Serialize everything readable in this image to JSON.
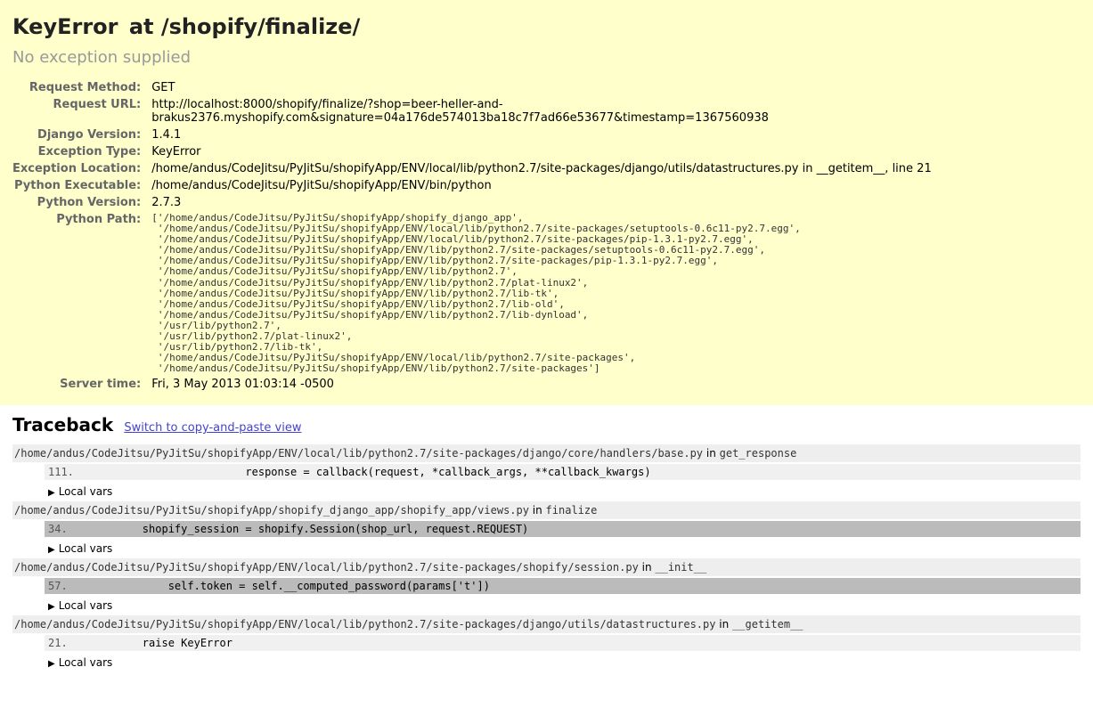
{
  "summary": {
    "heading_error": "KeyError",
    "heading_at": "at /shopify/finalize/",
    "exception_message": "No exception supplied",
    "rows": {
      "request_method_label": "Request Method:",
      "request_method": "GET",
      "request_url_label": "Request URL:",
      "request_url": "http://localhost:8000/shopify/finalize/?shop=beer-heller-and-brakus2376.myshopify.com&signature=04a176de574013ba18c7f7ad66e53677&timestamp=1367560938",
      "django_version_label": "Django Version:",
      "django_version": "1.4.1",
      "exception_type_label": "Exception Type:",
      "exception_type": "KeyError",
      "exception_location_label": "Exception Location:",
      "exception_location": "/home/andus/CodeJitsu/PyJitSu/shopifyApp/ENV/local/lib/python2.7/site-packages/django/utils/datastructures.py in __getitem__, line 21",
      "python_executable_label": "Python Executable:",
      "python_executable": "/home/andus/CodeJitsu/PyJitSu/shopifyApp/ENV/bin/python",
      "python_version_label": "Python Version:",
      "python_version": "2.7.3",
      "python_path_label": "Python Path:",
      "python_path": "['/home/andus/CodeJitsu/PyJitSu/shopifyApp/shopify_django_app',\n '/home/andus/CodeJitsu/PyJitSu/shopifyApp/ENV/local/lib/python2.7/site-packages/setuptools-0.6c11-py2.7.egg',\n '/home/andus/CodeJitsu/PyJitSu/shopifyApp/ENV/local/lib/python2.7/site-packages/pip-1.3.1-py2.7.egg',\n '/home/andus/CodeJitsu/PyJitSu/shopifyApp/ENV/lib/python2.7/site-packages/setuptools-0.6c11-py2.7.egg',\n '/home/andus/CodeJitsu/PyJitSu/shopifyApp/ENV/lib/python2.7/site-packages/pip-1.3.1-py2.7.egg',\n '/home/andus/CodeJitsu/PyJitSu/shopifyApp/ENV/lib/python2.7',\n '/home/andus/CodeJitsu/PyJitSu/shopifyApp/ENV/lib/python2.7/plat-linux2',\n '/home/andus/CodeJitsu/PyJitSu/shopifyApp/ENV/lib/python2.7/lib-tk',\n '/home/andus/CodeJitsu/PyJitSu/shopifyApp/ENV/lib/python2.7/lib-old',\n '/home/andus/CodeJitsu/PyJitSu/shopifyApp/ENV/lib/python2.7/lib-dynload',\n '/usr/lib/python2.7',\n '/usr/lib/python2.7/plat-linux2',\n '/usr/lib/python2.7/lib-tk',\n '/home/andus/CodeJitsu/PyJitSu/shopifyApp/ENV/local/lib/python2.7/site-packages',\n '/home/andus/CodeJitsu/PyJitSu/shopifyApp/ENV/lib/python2.7/site-packages']",
      "server_time_label": "Server time:",
      "server_time": "Fri, 3 May 2013 01:03:14 -0500"
    }
  },
  "traceback": {
    "heading": "Traceback",
    "switch_link": "Switch to copy-and-paste view",
    "local_vars_label": "Local vars",
    "in_word": "in",
    "frames": [
      {
        "file": "/home/andus/CodeJitsu/PyJitSu/shopifyApp/ENV/local/lib/python2.7/site-packages/django/core/handlers/base.py",
        "func": "get_response",
        "lineno": "111.",
        "code": "                        response = callback(request, *callback_args, **callback_kwargs)",
        "highlight": false
      },
      {
        "file": "/home/andus/CodeJitsu/PyJitSu/shopifyApp/shopify_django_app/shopify_app/views.py",
        "func": "finalize",
        "lineno": "34.",
        "code": "        shopify_session = shopify.Session(shop_url, request.REQUEST)",
        "highlight": true
      },
      {
        "file": "/home/andus/CodeJitsu/PyJitSu/shopifyApp/ENV/local/lib/python2.7/site-packages/shopify/session.py",
        "func": "__init__",
        "lineno": "57.",
        "code": "            self.token = self.__computed_password(params['t'])",
        "highlight": true
      },
      {
        "file": "/home/andus/CodeJitsu/PyJitSu/shopifyApp/ENV/local/lib/python2.7/site-packages/django/utils/datastructures.py",
        "func": "__getitem__",
        "lineno": "21.",
        "code": "        raise KeyError",
        "highlight": false
      }
    ]
  }
}
